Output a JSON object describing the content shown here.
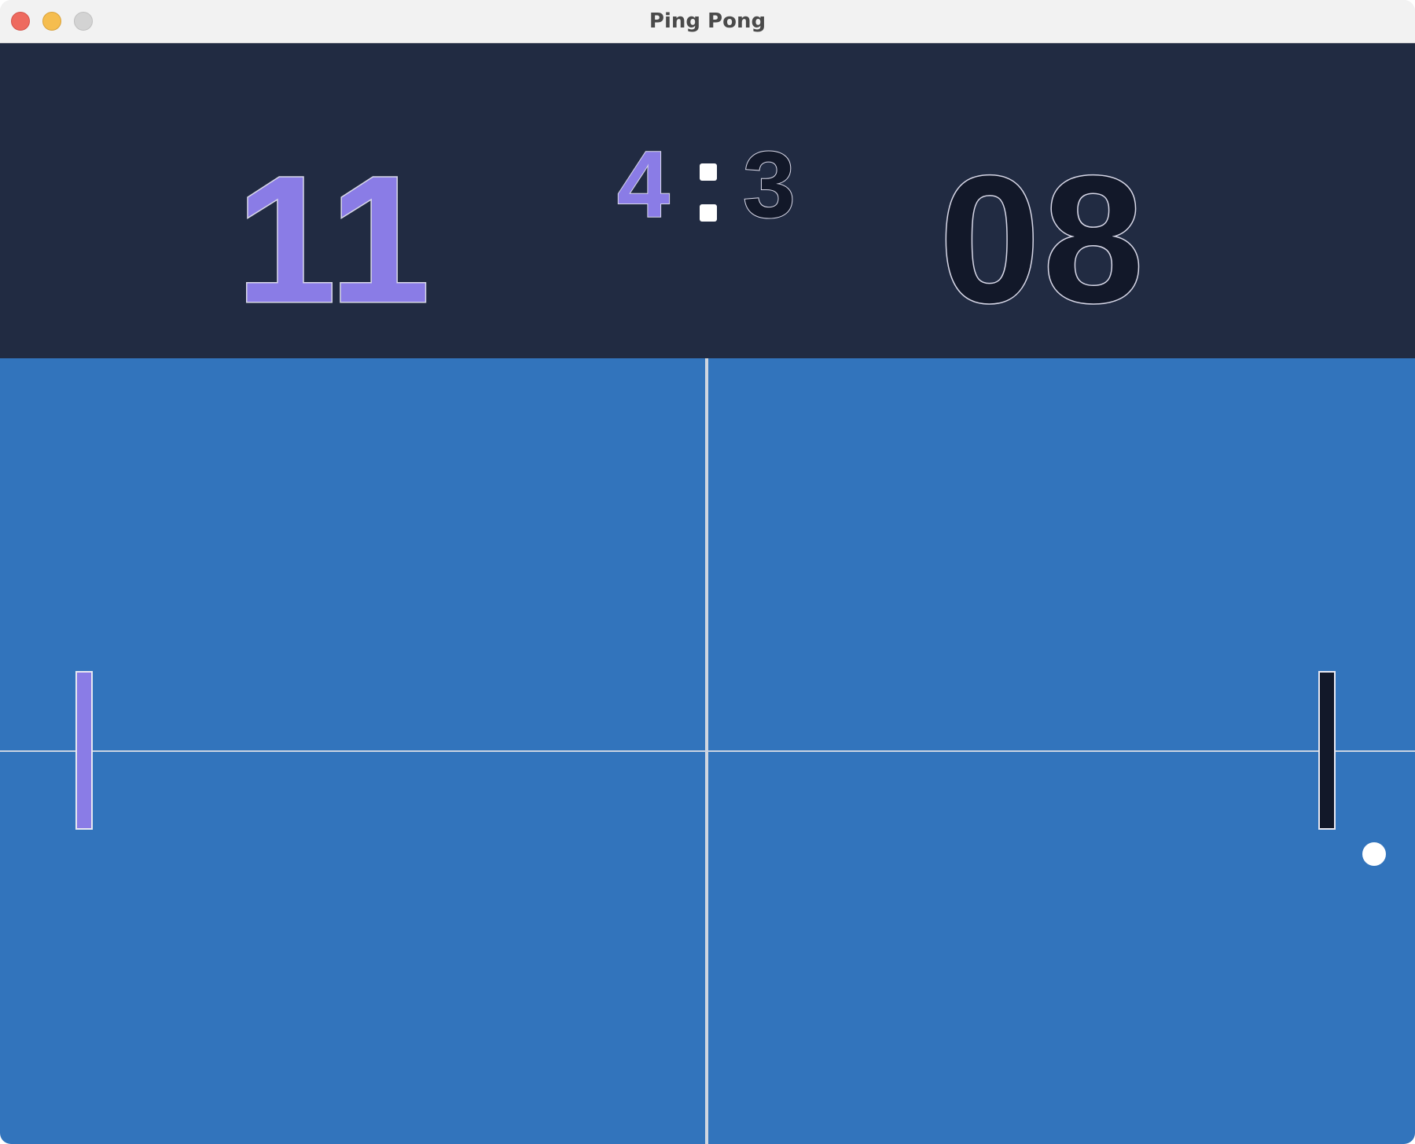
{
  "window": {
    "title": "Ping Pong"
  },
  "scoreboard": {
    "left_points": "11",
    "right_points": "08",
    "left_sets": "4",
    "right_sets": "3"
  },
  "colors": {
    "scoreboard_bg": "#212b42",
    "table_bg": "#3274bc",
    "player_left": "#8a7ce6",
    "player_right": "#121829",
    "ball": "#ffffff",
    "lines": "#d0d6e0"
  },
  "icons": [
    "close-button-icon",
    "minimize-button-icon",
    "zoom-button-icon"
  ]
}
